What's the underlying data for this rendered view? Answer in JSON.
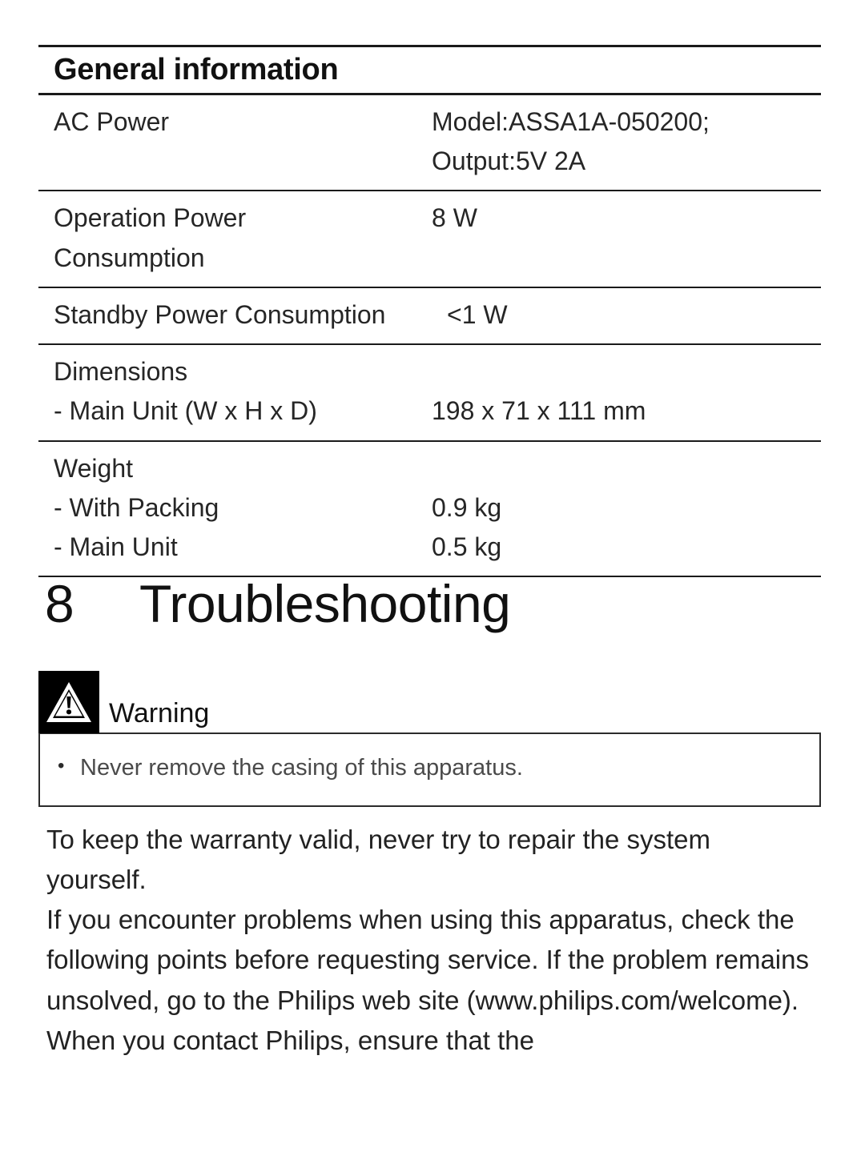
{
  "spec_table": {
    "heading": "General information",
    "rows": [
      {
        "label": "AC Power",
        "value": "Model:ASSA1A-050200;\nOutput:5V 2A",
        "wide_label": false
      },
      {
        "label": "Operation Power\nConsumption",
        "value": "8 W",
        "wide_label": false
      },
      {
        "label": "Standby Power Consumption",
        "value": "<1 W",
        "wide_label": true
      },
      {
        "label": "Dimensions\n- Main Unit (W x H x D)",
        "value": "\n198 x 71 x 111 mm",
        "wide_label": false
      },
      {
        "label": "Weight\n- With Packing\n- Main Unit",
        "value": "\n0.9 kg\n0.5 kg",
        "wide_label": false
      }
    ]
  },
  "chapter": {
    "number": "8",
    "title": "Troubleshooting"
  },
  "warning": {
    "icon": "warning-triangle-icon",
    "label": "Warning",
    "items": [
      {
        "bullet": "•",
        "text": "Never remove the casing of this apparatus."
      }
    ]
  },
  "body": {
    "paragraph_1": "To keep the warranty valid, never try to repair the system yourself.",
    "paragraph_2": "If you encounter problems when using this apparatus, check the following points before requesting service. If the problem remains unsolved, go to the Philips web site (www.philips.com/welcome). When you contact Philips, ensure that the"
  },
  "colors": {
    "page_background": "#ffffff",
    "text": "#1a1a1a",
    "rule": "#1a1a1a",
    "warning_icon_background": "#000000"
  }
}
